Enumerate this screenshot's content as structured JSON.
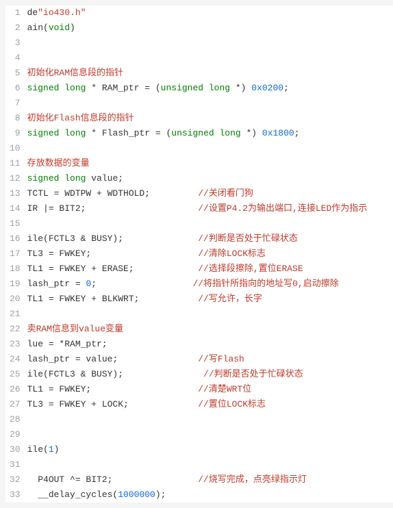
{
  "lines": [
    {
      "n": 1,
      "tokens": [
        [
          "plain",
          "de"
        ],
        [
          "str",
          "\"io430.h\""
        ]
      ]
    },
    {
      "n": 2,
      "tokens": [
        [
          "plain",
          "ain("
        ],
        [
          "kw",
          "void"
        ],
        [
          "plain",
          ")"
        ]
      ]
    },
    {
      "n": 3,
      "tokens": []
    },
    {
      "n": 4,
      "tokens": []
    },
    {
      "n": 5,
      "tokens": [
        [
          "com",
          "初始化RAM信息段的指针"
        ]
      ]
    },
    {
      "n": 6,
      "tokens": [
        [
          "kw",
          "signed long"
        ],
        [
          "plain",
          " * RAM_ptr = ("
        ],
        [
          "kw",
          "unsigned long"
        ],
        [
          "plain",
          " *) "
        ],
        [
          "num",
          "0x0200"
        ],
        [
          "plain",
          ";"
        ]
      ]
    },
    {
      "n": 7,
      "tokens": []
    },
    {
      "n": 8,
      "tokens": [
        [
          "com",
          "初始化Flash信息段的指针"
        ]
      ]
    },
    {
      "n": 9,
      "tokens": [
        [
          "kw",
          "signed long"
        ],
        [
          "plain",
          " * Flash_ptr = ("
        ],
        [
          "kw",
          "unsigned long"
        ],
        [
          "plain",
          " *) "
        ],
        [
          "num",
          "0x1800"
        ],
        [
          "plain",
          ";"
        ]
      ]
    },
    {
      "n": 10,
      "tokens": []
    },
    {
      "n": 11,
      "tokens": [
        [
          "com",
          "存放数据的变量"
        ]
      ]
    },
    {
      "n": 12,
      "tokens": [
        [
          "kw",
          "signed long"
        ],
        [
          "plain",
          " value;"
        ]
      ]
    },
    {
      "n": 13,
      "tokens": [
        [
          "plain",
          "TCTL = WDTPW + WDTHOLD;         "
        ],
        [
          "com",
          "//关闭看门狗"
        ]
      ]
    },
    {
      "n": 14,
      "tokens": [
        [
          "plain",
          "IR |= BIT2;                     "
        ],
        [
          "com",
          "//设置P4.2为输出端口,连接LED作为指示"
        ]
      ]
    },
    {
      "n": 15,
      "tokens": []
    },
    {
      "n": 16,
      "tokens": [
        [
          "plain",
          "ile(FCTL3 & BUSY);              "
        ],
        [
          "com",
          "//判断是否处于忙碌状态"
        ]
      ]
    },
    {
      "n": 17,
      "tokens": [
        [
          "plain",
          "TL3 = FWKEY;                    "
        ],
        [
          "com",
          "//清除LOCK标志"
        ]
      ]
    },
    {
      "n": 18,
      "tokens": [
        [
          "plain",
          "TL1 = FWKEY + ERASE;            "
        ],
        [
          "com",
          "//选择段擦除,置位ERASE"
        ]
      ]
    },
    {
      "n": 19,
      "tokens": [
        [
          "plain",
          "lash_ptr = "
        ],
        [
          "num",
          "0"
        ],
        [
          "plain",
          ";                  "
        ],
        [
          "com",
          "//将指针所指向的地址写0,启动擦除"
        ]
      ]
    },
    {
      "n": 20,
      "tokens": [
        [
          "plain",
          "TL1 = FWKEY + BLKWRT;           "
        ],
        [
          "com",
          "//写允许，长字"
        ]
      ]
    },
    {
      "n": 21,
      "tokens": []
    },
    {
      "n": 22,
      "tokens": [
        [
          "com",
          "卖RAM信息到value变量"
        ]
      ]
    },
    {
      "n": 23,
      "tokens": [
        [
          "plain",
          "lue = *RAM_ptr;"
        ]
      ]
    },
    {
      "n": 24,
      "tokens": [
        [
          "plain",
          "lash_ptr = value;               "
        ],
        [
          "com",
          "//写Flash"
        ]
      ]
    },
    {
      "n": 25,
      "tokens": [
        [
          "plain",
          "ile(FCTL3 & BUSY);               "
        ],
        [
          "com",
          "//判断是否处于忙碌状态"
        ]
      ]
    },
    {
      "n": 26,
      "tokens": [
        [
          "plain",
          "TL1 = FWKEY;                    "
        ],
        [
          "com",
          "//清楚WRT位"
        ]
      ]
    },
    {
      "n": 27,
      "tokens": [
        [
          "plain",
          "TL3 = FWKEY + LOCK;             "
        ],
        [
          "com",
          "//置位LOCK标志"
        ]
      ]
    },
    {
      "n": 28,
      "tokens": []
    },
    {
      "n": 29,
      "tokens": []
    },
    {
      "n": 30,
      "tokens": [
        [
          "plain",
          "ile("
        ],
        [
          "num",
          "1"
        ],
        [
          "plain",
          ")"
        ]
      ]
    },
    {
      "n": 31,
      "tokens": []
    },
    {
      "n": 32,
      "tokens": [
        [
          "plain",
          "  P4OUT ^= BIT2;                "
        ],
        [
          "com",
          "//烧写完成，点亮绿指示灯"
        ]
      ]
    },
    {
      "n": 33,
      "tokens": [
        [
          "plain",
          "  __delay_cycles("
        ],
        [
          "num",
          "1000000"
        ],
        [
          "plain",
          ");"
        ]
      ]
    }
  ]
}
